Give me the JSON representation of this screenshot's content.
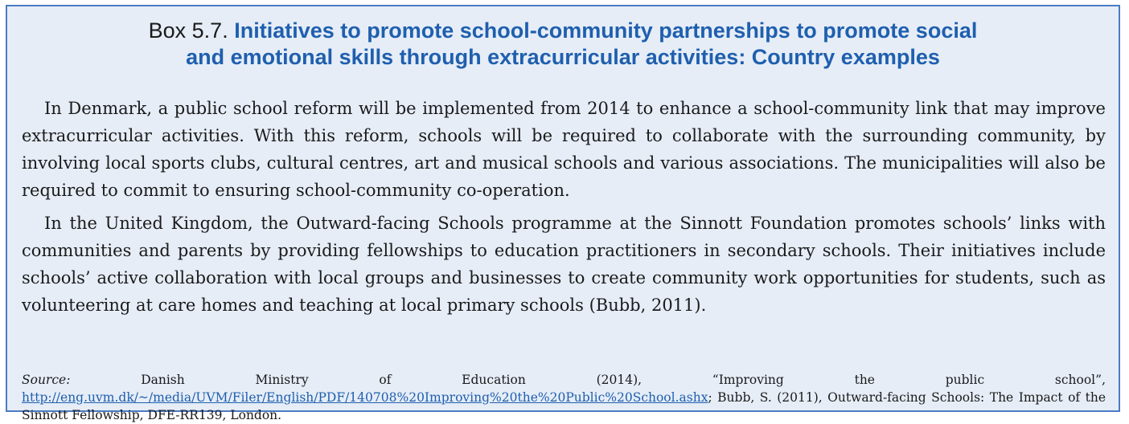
{
  "box": {
    "label": "Box 5.7.",
    "title": "Initiatives to promote school-community partnerships to promote social and emotional skills through extracurricular activities: Country examples",
    "title_line1": "Initiatives to promote school-community partnerships to promote social",
    "title_line2": "and emotional skills through extracurricular activities: Country examples"
  },
  "paragraphs": [
    "In Denmark, a public school reform will be implemented from 2014 to enhance a school-community link that may improve extracurricular activities. With this reform, schools will be required to collaborate with the surrounding community, by involving local sports clubs, cultural centres, art and musical schools and various associations. The municipalities will also be required to commit to ensuring school-community co-operation.",
    "In the United Kingdom, the Outward-facing Schools programme at the Sinnott Foundation promotes schools’ links with communities and parents by providing fellowships to education practitioners in secondary schools. Their initiatives include schools’ active collaboration with local groups and businesses to create community work opportunities for students, such as volunteering at care homes and teaching at local primary schools (Bubb, 2011)."
  ],
  "source": {
    "label": "Source:",
    "text_before_link": "Danish Ministry of Education (2014), “Improving the public school”,",
    "link_text": "http://eng.uvm.dk/~/media/UVM/Filer/English/PDF/140708%20Improving%20the%20Public%20School.ashx",
    "text_after_link": "; Bubb, S. (2011), Outward-facing Schools: The Impact of the Sinnott Fellowship, DFE-RR139, London."
  },
  "colors": {
    "accent": "#1f5fae",
    "box_background": "#e6edf7",
    "box_border": "#4a7bc4"
  }
}
